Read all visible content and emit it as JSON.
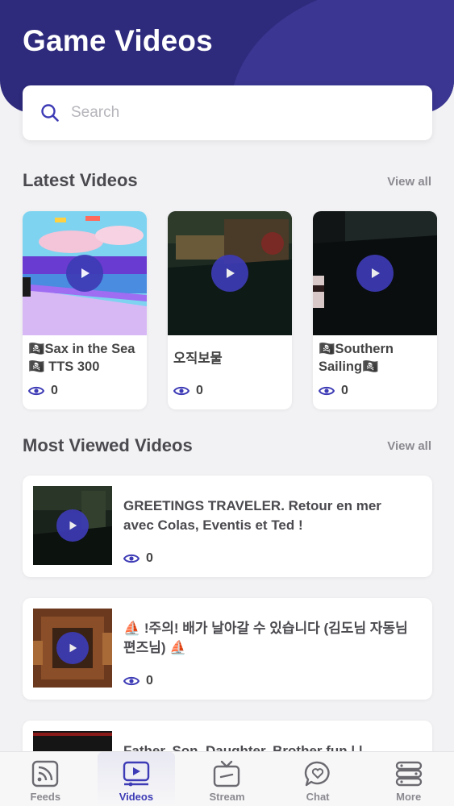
{
  "page": {
    "title": "Game Videos"
  },
  "search": {
    "placeholder": "Search",
    "value": ""
  },
  "latest": {
    "title": "Latest Videos",
    "view_all": "View all",
    "items": [
      {
        "title": "🏴‍☠️Sax in the Sea🏴‍☠️ TTS 300",
        "views": "0"
      },
      {
        "title": "오직보물",
        "views": "0"
      },
      {
        "title": "🏴‍☠️Southern Sailing🏴‍☠️",
        "views": "0"
      }
    ]
  },
  "most_viewed": {
    "title": "Most Viewed Videos",
    "view_all": "View all",
    "items": [
      {
        "title": "GREETINGS TRAVELER. Retour en mer avec Colas, Eventis et Ted !",
        "views": "0"
      },
      {
        "title": "⛵ !주의! 배가 날아갈 수 있습니다 (김도님 자동님 편즈님) ⛵",
        "views": "0"
      },
      {
        "title": "Father, Son, Daughter, Brother fun | |",
        "views": ""
      }
    ]
  },
  "tabs": [
    {
      "label": "Feeds",
      "icon": "feeds-icon",
      "active": false
    },
    {
      "label": "Videos",
      "icon": "videos-icon",
      "active": true
    },
    {
      "label": "Stream",
      "icon": "stream-icon",
      "active": false
    },
    {
      "label": "Chat",
      "icon": "chat-icon",
      "active": false
    },
    {
      "label": "More",
      "icon": "more-icon",
      "active": false
    }
  ],
  "colors": {
    "accent": "#3d3bb5",
    "header": "#2e2a7c",
    "background": "#f2f2f4"
  }
}
